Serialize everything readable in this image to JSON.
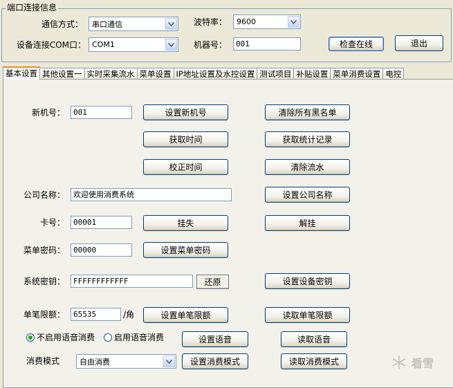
{
  "port_group": {
    "legend": "端口连接信息",
    "comm_mode_label": "通信方式：",
    "comm_mode_value": "串口通信",
    "baud_label": "波特率：",
    "baud_value": "9600",
    "device_port_label": "设备连接COM口：",
    "device_port_value": "COM1",
    "machine_no_label": "机器号：",
    "machine_no_value": "001",
    "check_online_label": "检查在线",
    "exit_label": "退出"
  },
  "tabs": [
    "基本设置",
    "其他设置一",
    "实时采集流水",
    "菜单设置",
    "IP地址设置及水控设置",
    "测试项目",
    "补贴设置",
    "菜单消费设置",
    "电控"
  ],
  "active_tab": 0,
  "basic": {
    "new_machine_label": "新机号：",
    "new_machine_value": "001",
    "set_new_machine": "设置新机号",
    "clear_blacklist": "清除所有黑名单",
    "get_time": "获取时间",
    "get_stats": "获取统计记录",
    "calibrate_time": "校正时间",
    "clear_flow": "清除流水",
    "company_label": "公司名称：",
    "company_value": "欢迎使用消费系统",
    "set_company": "设置公司名称",
    "card_label": "卡号：",
    "card_value": "00001",
    "report_loss": "挂失",
    "unlock": "解挂",
    "menu_pwd_label": "菜单密码：",
    "menu_pwd_value": "00000",
    "set_menu_pwd": "设置菜单密码",
    "sys_key_label": "系统密钥：",
    "sys_key_value": "FFFFFFFFFFFF",
    "restore": "还原",
    "set_device_key": "设置设备密钥",
    "limit_label": "单笔限额：",
    "limit_value": "65535",
    "limit_unit": "/角",
    "set_limit": "设置单笔限额",
    "read_limit": "读取单笔限额",
    "voice_off": "不启用语音消费",
    "voice_on": "启用语音消费",
    "voice_selected": "off",
    "set_voice": "设置语音",
    "read_voice": "读取语音",
    "mode_label": "消费模式",
    "mode_value": "自由消费",
    "set_mode": "设置消费模式",
    "read_mode": "读取消费模式"
  },
  "watermark": "看雪",
  "colors": {
    "window_bg": "#ece9d8",
    "panel_bg": "#f2f1ea",
    "active_tab_accent": "#e68b2c",
    "radio_dot": "#21a121"
  }
}
